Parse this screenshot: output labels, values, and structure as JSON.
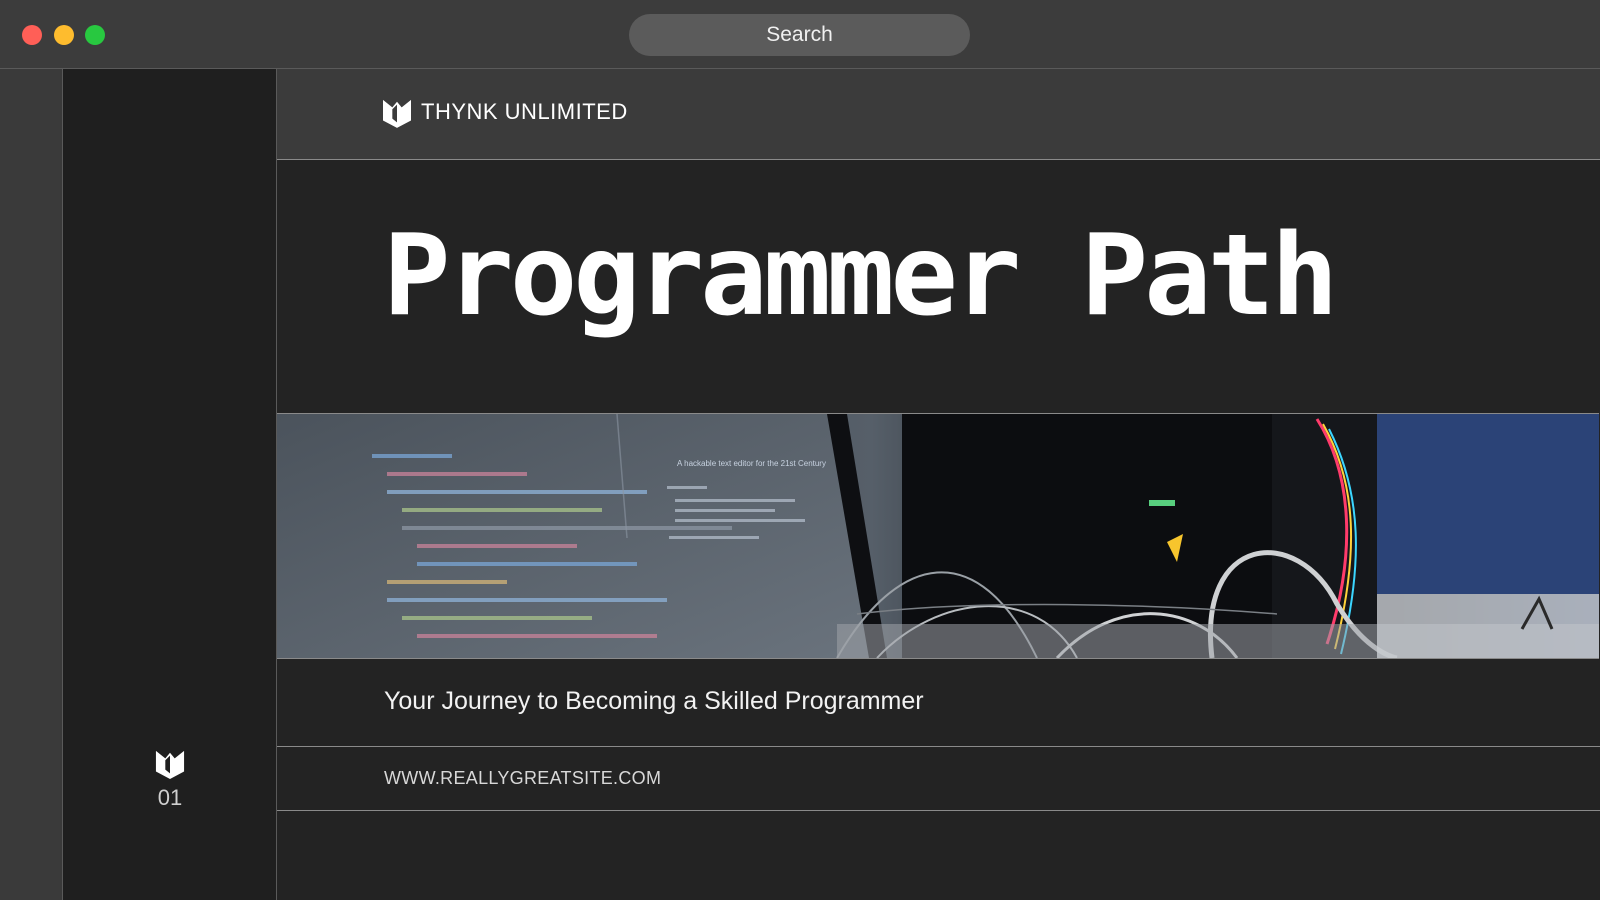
{
  "window": {
    "search_label": "Search"
  },
  "thumbnails": [
    {
      "number": "01"
    }
  ],
  "slide": {
    "brand_name": "THYNK UNLIMITED",
    "title": "Programmer Path",
    "subtitle": "Your Journey to Becoming a Skilled Programmer",
    "website": "WWW.REALLYGREATSITE.COM",
    "image_screen_heading": "A hackable text editor for the 21st Century"
  },
  "colors": {
    "background": "#3a3a3a",
    "slide_background": "#232323",
    "header_background": "#3b3b3b",
    "thumbnail_panel": "#1f1f1f",
    "close": "#ff5f57",
    "minimize": "#febc2e",
    "zoom": "#28c840"
  }
}
